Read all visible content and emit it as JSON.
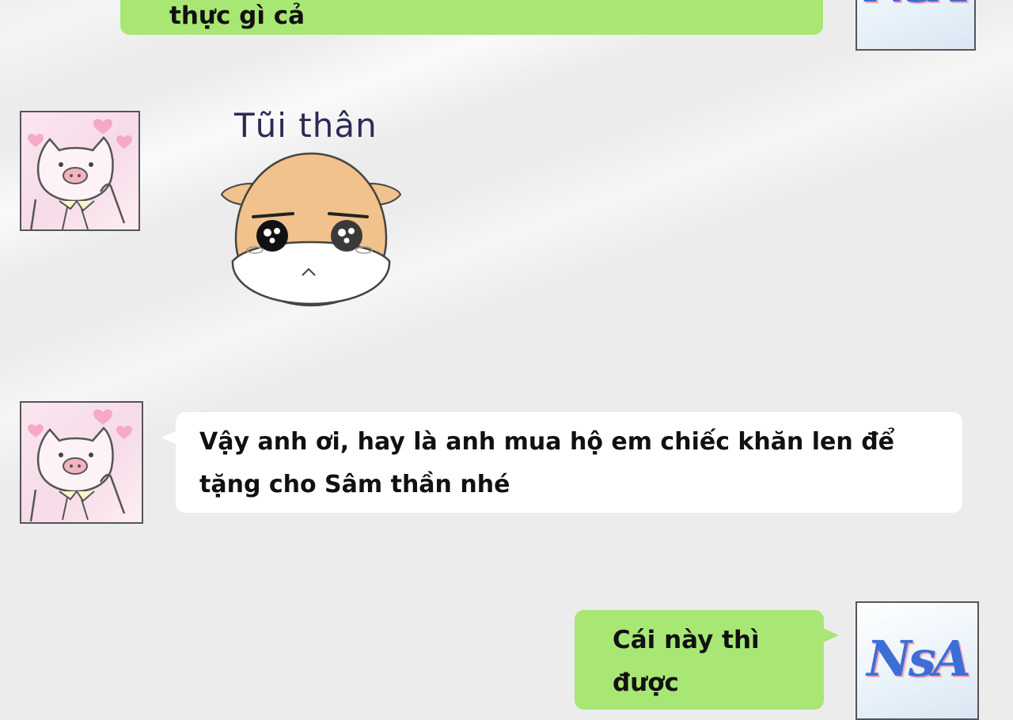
{
  "messages": {
    "top_reply": {
      "text": "thực gì cả"
    },
    "sticker": {
      "caption": "Tũi thân",
      "name": "sad-hamster-sticker"
    },
    "request": {
      "line1": "Vậy anh ơi, hay là anh mua hộ em chiếc khăn len để",
      "line2": "tặng cho Sâm thần nhé"
    },
    "answer": {
      "line1": "Cái này thì",
      "line2": "được"
    }
  },
  "avatars": {
    "other_user": {
      "icon": "pig-avatar-icon"
    },
    "self_user": {
      "icon": "nsa-logo-avatar",
      "logo_text": "NsA"
    }
  },
  "colors": {
    "sent_bubble": "#a9e775",
    "received_bubble": "#ffffff",
    "background": "#ececec"
  }
}
